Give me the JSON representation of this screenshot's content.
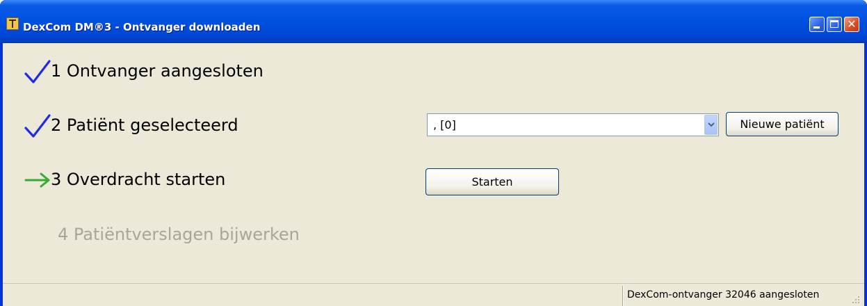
{
  "window": {
    "title": "DexCom DM®3 - Ontvanger downloaden",
    "controls": [
      "minimize-icon",
      "maximize-icon",
      "close-icon"
    ]
  },
  "steps": [
    {
      "label": "1 Ontvanger aangesloten",
      "status": "done",
      "icon": "checkmark-icon",
      "color": "#1f2be8"
    },
    {
      "label": "2 Patiënt geselecteerd",
      "status": "done",
      "icon": "checkmark-icon",
      "color": "#1f2be8"
    },
    {
      "label": "3 Overdracht starten",
      "status": "current",
      "icon": "arrow-right-icon",
      "color": "#3aa935"
    },
    {
      "label": "4 Patiëntverslagen bijwerken",
      "status": "pending",
      "icon": null,
      "color": "#a8a69b"
    }
  ],
  "patient_select": {
    "value": ",  [0]"
  },
  "new_patient_button": {
    "label": "Nieuwe patiënt"
  },
  "start_button": {
    "label": "Starten"
  },
  "statusbar": {
    "text": "DexCom-ontvanger 32046 aangesloten"
  }
}
